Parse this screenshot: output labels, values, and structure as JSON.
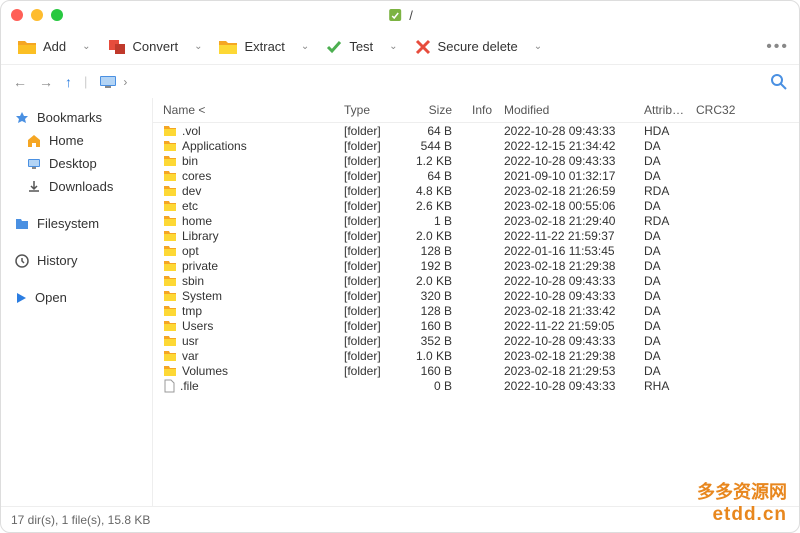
{
  "window": {
    "title": "/"
  },
  "toolbar": {
    "add": "Add",
    "convert": "Convert",
    "extract": "Extract",
    "test": "Test",
    "secure_delete": "Secure delete"
  },
  "sidebar": {
    "bookmarks": "Bookmarks",
    "home": "Home",
    "desktop": "Desktop",
    "downloads": "Downloads",
    "filesystem": "Filesystem",
    "history": "History",
    "open": "Open"
  },
  "columns": {
    "name": "Name <",
    "type": "Type",
    "size": "Size",
    "info": "Info",
    "modified": "Modified",
    "attrib": "Attrib…",
    "crc32": "CRC32"
  },
  "files": [
    {
      "name": ".vol",
      "type": "[folder]",
      "size": "64 B",
      "modified": "2022-10-28 09:43:33",
      "attrib": "HDA",
      "icon": "folder"
    },
    {
      "name": "Applications",
      "type": "[folder]",
      "size": "544 B",
      "modified": "2022-12-15 21:34:42",
      "attrib": "DA",
      "icon": "folder"
    },
    {
      "name": "bin",
      "type": "[folder]",
      "size": "1.2 KB",
      "modified": "2022-10-28 09:43:33",
      "attrib": "DA",
      "icon": "folder"
    },
    {
      "name": "cores",
      "type": "[folder]",
      "size": "64 B",
      "modified": "2021-09-10 01:32:17",
      "attrib": "DA",
      "icon": "folder"
    },
    {
      "name": "dev",
      "type": "[folder]",
      "size": "4.8 KB",
      "modified": "2023-02-18 21:26:59",
      "attrib": "RDA",
      "icon": "folder"
    },
    {
      "name": "etc",
      "type": "[folder]",
      "size": "2.6 KB",
      "modified": "2023-02-18 00:55:06",
      "attrib": "DA",
      "icon": "folder"
    },
    {
      "name": "home",
      "type": "[folder]",
      "size": "1 B",
      "modified": "2023-02-18 21:29:40",
      "attrib": "RDA",
      "icon": "folder"
    },
    {
      "name": "Library",
      "type": "[folder]",
      "size": "2.0 KB",
      "modified": "2022-11-22 21:59:37",
      "attrib": "DA",
      "icon": "folder"
    },
    {
      "name": "opt",
      "type": "[folder]",
      "size": "128 B",
      "modified": "2022-01-16 11:53:45",
      "attrib": "DA",
      "icon": "folder"
    },
    {
      "name": "private",
      "type": "[folder]",
      "size": "192 B",
      "modified": "2023-02-18 21:29:38",
      "attrib": "DA",
      "icon": "folder"
    },
    {
      "name": "sbin",
      "type": "[folder]",
      "size": "2.0 KB",
      "modified": "2022-10-28 09:43:33",
      "attrib": "DA",
      "icon": "folder"
    },
    {
      "name": "System",
      "type": "[folder]",
      "size": "320 B",
      "modified": "2022-10-28 09:43:33",
      "attrib": "DA",
      "icon": "folder"
    },
    {
      "name": "tmp",
      "type": "[folder]",
      "size": "128 B",
      "modified": "2023-02-18 21:33:42",
      "attrib": "DA",
      "icon": "folder"
    },
    {
      "name": "Users",
      "type": "[folder]",
      "size": "160 B",
      "modified": "2022-11-22 21:59:05",
      "attrib": "DA",
      "icon": "folder"
    },
    {
      "name": "usr",
      "type": "[folder]",
      "size": "352 B",
      "modified": "2022-10-28 09:43:33",
      "attrib": "DA",
      "icon": "folder"
    },
    {
      "name": "var",
      "type": "[folder]",
      "size": "1.0 KB",
      "modified": "2023-02-18 21:29:38",
      "attrib": "DA",
      "icon": "folder"
    },
    {
      "name": "Volumes",
      "type": "[folder]",
      "size": "160 B",
      "modified": "2023-02-18 21:29:53",
      "attrib": "DA",
      "icon": "folder"
    },
    {
      "name": ".file",
      "type": "",
      "size": "0 B",
      "modified": "2022-10-28 09:43:33",
      "attrib": "RHA",
      "icon": "file"
    }
  ],
  "status": "17 dir(s), 1 file(s), 15.8 KB",
  "watermark": {
    "line1": "多多资源网",
    "line2": "etdd.cn"
  }
}
